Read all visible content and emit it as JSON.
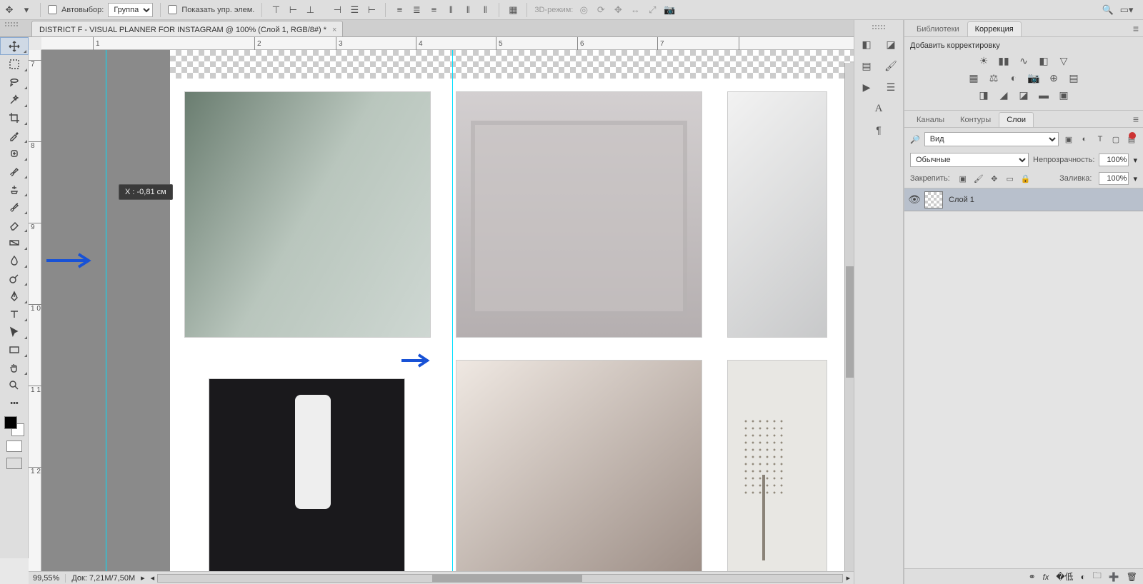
{
  "optionsBar": {
    "autoSelectLabel": "Автовыбор:",
    "autoSelectMode": "Группа",
    "showTransform": "Показать упр. элем.",
    "mode3dLabel": "3D-режим:"
  },
  "docTab": {
    "title": "DISTRICT F -  VISUAL PLANNER FOR INSTAGRAM @ 100% (Слой 1, RGB/8#) *"
  },
  "rulerH": {
    "labels": [
      "1",
      "2",
      "3",
      "4",
      "5",
      "6",
      "7"
    ]
  },
  "rulerV": {
    "labels": [
      "7",
      "8",
      "9",
      "1 0",
      "1 1",
      "1 2"
    ]
  },
  "guideHint": {
    "text": "X :   -0,81 см"
  },
  "status": {
    "zoom": "99,55%",
    "docInfo": "Док: 7,21M/7,50M"
  },
  "panels": {
    "group1": {
      "tabs": [
        "Библиотеки",
        "Коррекция"
      ],
      "active": 1,
      "addText": "Добавить корректировку"
    },
    "group2": {
      "tabs": [
        "Каналы",
        "Контуры",
        "Слои"
      ],
      "active": 2
    }
  },
  "layers": {
    "searchPlaceholder": "Вид",
    "blendMode": "Обычные",
    "opacityLabel": "Непрозрачность:",
    "opacityValue": "100%",
    "lockLabel": "Закрепить:",
    "fillLabel": "Заливка:",
    "fillValue": "100%",
    "items": [
      {
        "name": "Слой 1",
        "visible": true
      }
    ]
  }
}
